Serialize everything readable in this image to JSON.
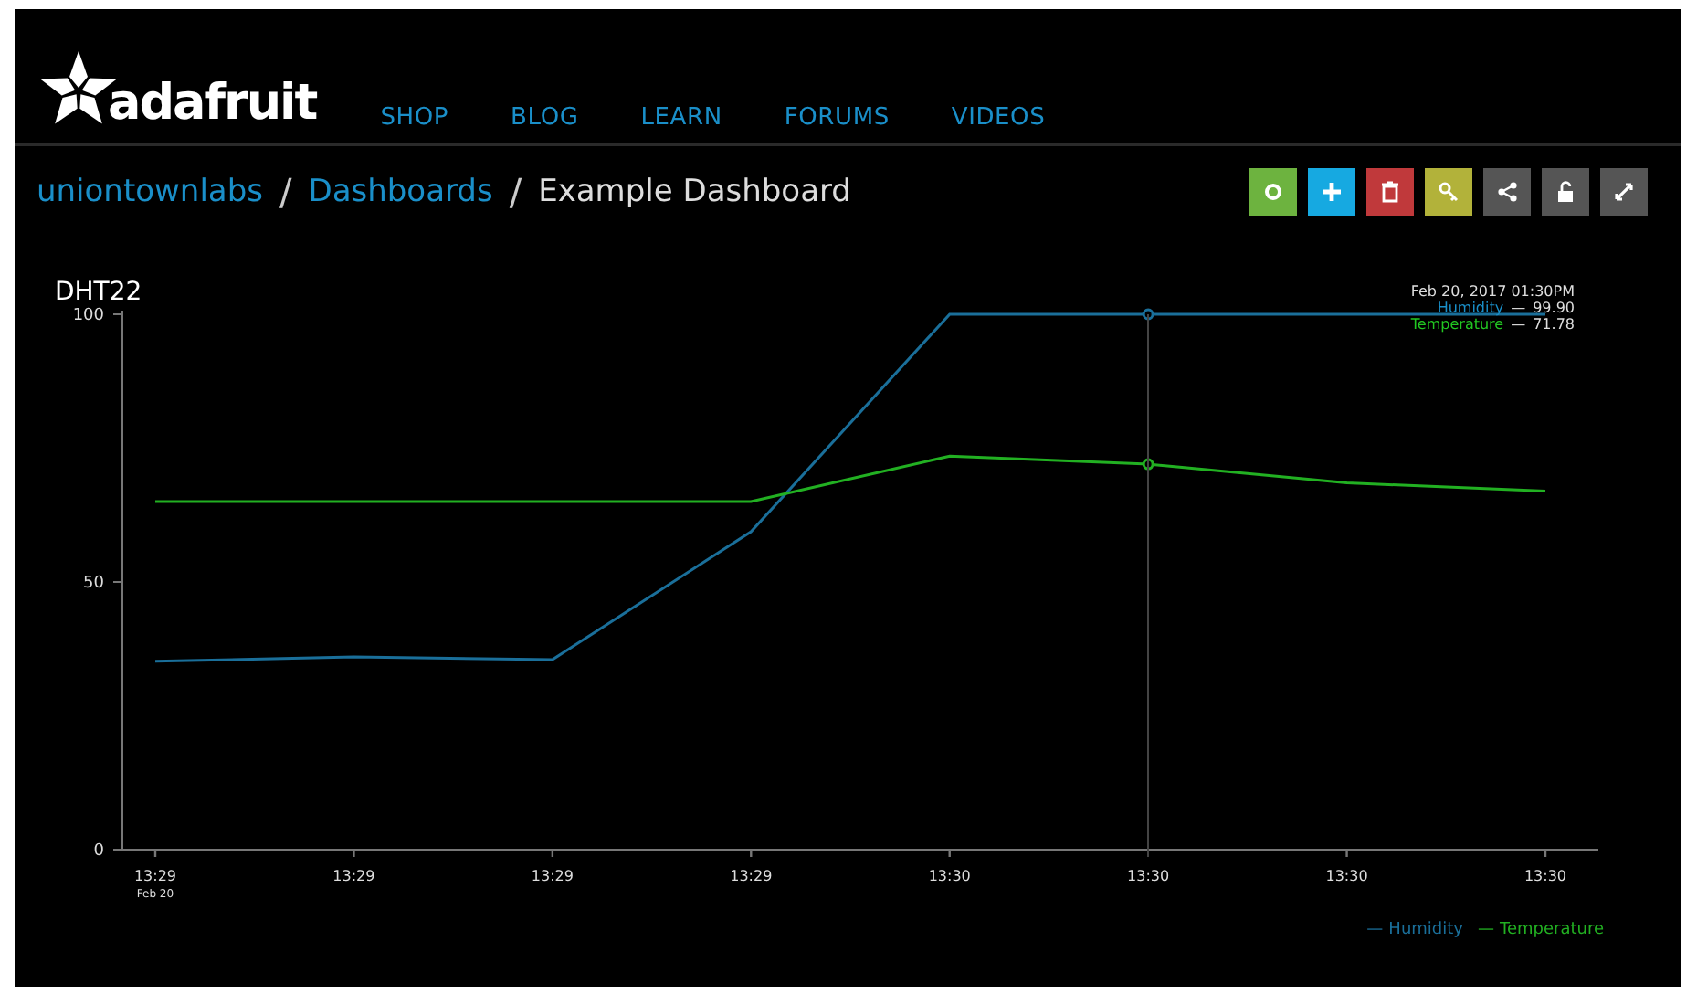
{
  "brand": {
    "name": "adafruit"
  },
  "nav": [
    "SHOP",
    "BLOG",
    "LEARN",
    "FORUMS",
    "VIDEOS"
  ],
  "breadcrumb": [
    {
      "label": "uniontownlabs",
      "link": true
    },
    {
      "label": "Dashboards",
      "link": true
    },
    {
      "label": "Example Dashboard",
      "link": false
    }
  ],
  "separators": [
    "/",
    "/"
  ],
  "toolbar": [
    {
      "kind": "settings",
      "color": "#6db33f"
    },
    {
      "kind": "add",
      "color": "#16a9e1"
    },
    {
      "kind": "delete",
      "color": "#c0393b"
    },
    {
      "kind": "key",
      "color": "#b2b23a"
    },
    {
      "kind": "share",
      "color": "#555555"
    },
    {
      "kind": "lock",
      "color": "#555555"
    },
    {
      "kind": "expand",
      "color": "#555555"
    }
  ],
  "block": {
    "title": "DHT22",
    "tooltip": {
      "time": "Feb 20, 2017  01:30PM",
      "rows": [
        {
          "name": "Humidity",
          "dash": "—",
          "value": "99.90",
          "color": "#1a8fc9"
        },
        {
          "name": "Temperature",
          "dash": "—",
          "value": "71.78",
          "color": "#22c722"
        }
      ],
      "hovered": [
        false,
        false,
        false,
        false,
        false,
        true,
        false,
        false
      ]
    },
    "date_label": "Feb 20",
    "legend_marks": [
      "—",
      "—"
    ],
    "chart_data": {
      "type": "line",
      "categories": [
        "13:29",
        "13:29",
        "13:29",
        "13:29",
        "13:30",
        "13:30",
        "13:30",
        "13:30"
      ],
      "ylim": [
        0,
        100
      ],
      "yticks": [
        0,
        50,
        100
      ],
      "series": [
        {
          "name": "Humidity",
          "color": "#1a6f9a",
          "values": [
            35.2,
            36,
            35.5,
            59.4,
            100,
            100,
            100,
            100
          ]
        },
        {
          "name": "Temperature",
          "color": "#22b022",
          "values": [
            65,
            65,
            65,
            65,
            73.5,
            72,
            68.5,
            67
          ]
        }
      ]
    }
  }
}
